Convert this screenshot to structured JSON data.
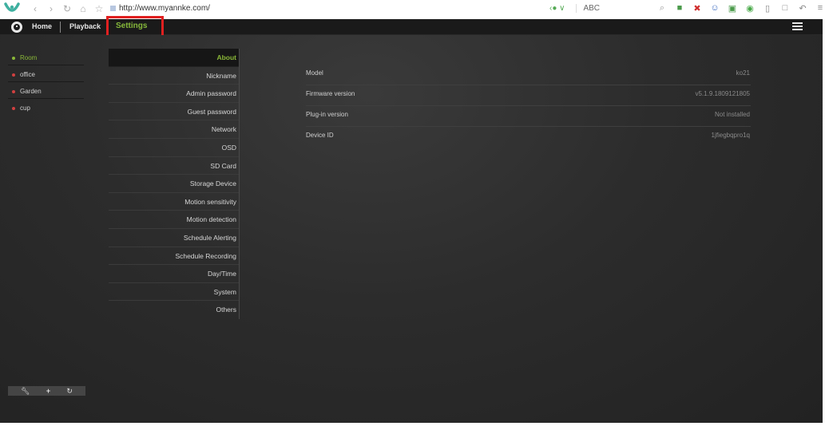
{
  "browser": {
    "url": "http://www.myannke.com/",
    "abc_label": "ABC",
    "nav_icons": [
      "back-icon",
      "forward-icon",
      "refresh-icon",
      "home-icon",
      "star-icon"
    ]
  },
  "header": {
    "home_label": "Home",
    "playback_label": "Playback",
    "settings_label": "Settings",
    "accent_color": "#86b83a",
    "highlight_color": "#e02020"
  },
  "cameras": [
    {
      "name": "Room",
      "status": "online"
    },
    {
      "name": "office",
      "status": "offline"
    },
    {
      "name": "Garden",
      "status": "offline"
    },
    {
      "name": "cup",
      "status": "offline"
    }
  ],
  "toolbar": {
    "icons": [
      "wrench-icon",
      "plus-icon",
      "refresh-icon"
    ]
  },
  "settings_menu": [
    {
      "label": "About",
      "active": true
    },
    {
      "label": "Nickname"
    },
    {
      "label": "Admin password"
    },
    {
      "label": "Guest password"
    },
    {
      "label": "Network"
    },
    {
      "label": "OSD"
    },
    {
      "label": "SD Card"
    },
    {
      "label": "Storage Device"
    },
    {
      "label": "Motion sensitivity"
    },
    {
      "label": "Motion detection"
    },
    {
      "label": "Schedule Alerting"
    },
    {
      "label": "Schedule Recording"
    },
    {
      "label": "Day/Time"
    },
    {
      "label": "System"
    },
    {
      "label": "Others"
    }
  ],
  "about": [
    {
      "label": "Model",
      "value": "ko21"
    },
    {
      "label": "Firmware version",
      "value": "v5.1.9.1809121805"
    },
    {
      "label": "Plug-in version",
      "value": "Not installed"
    },
    {
      "label": "Device ID",
      "value": "1jfiegbqpro1q"
    }
  ]
}
